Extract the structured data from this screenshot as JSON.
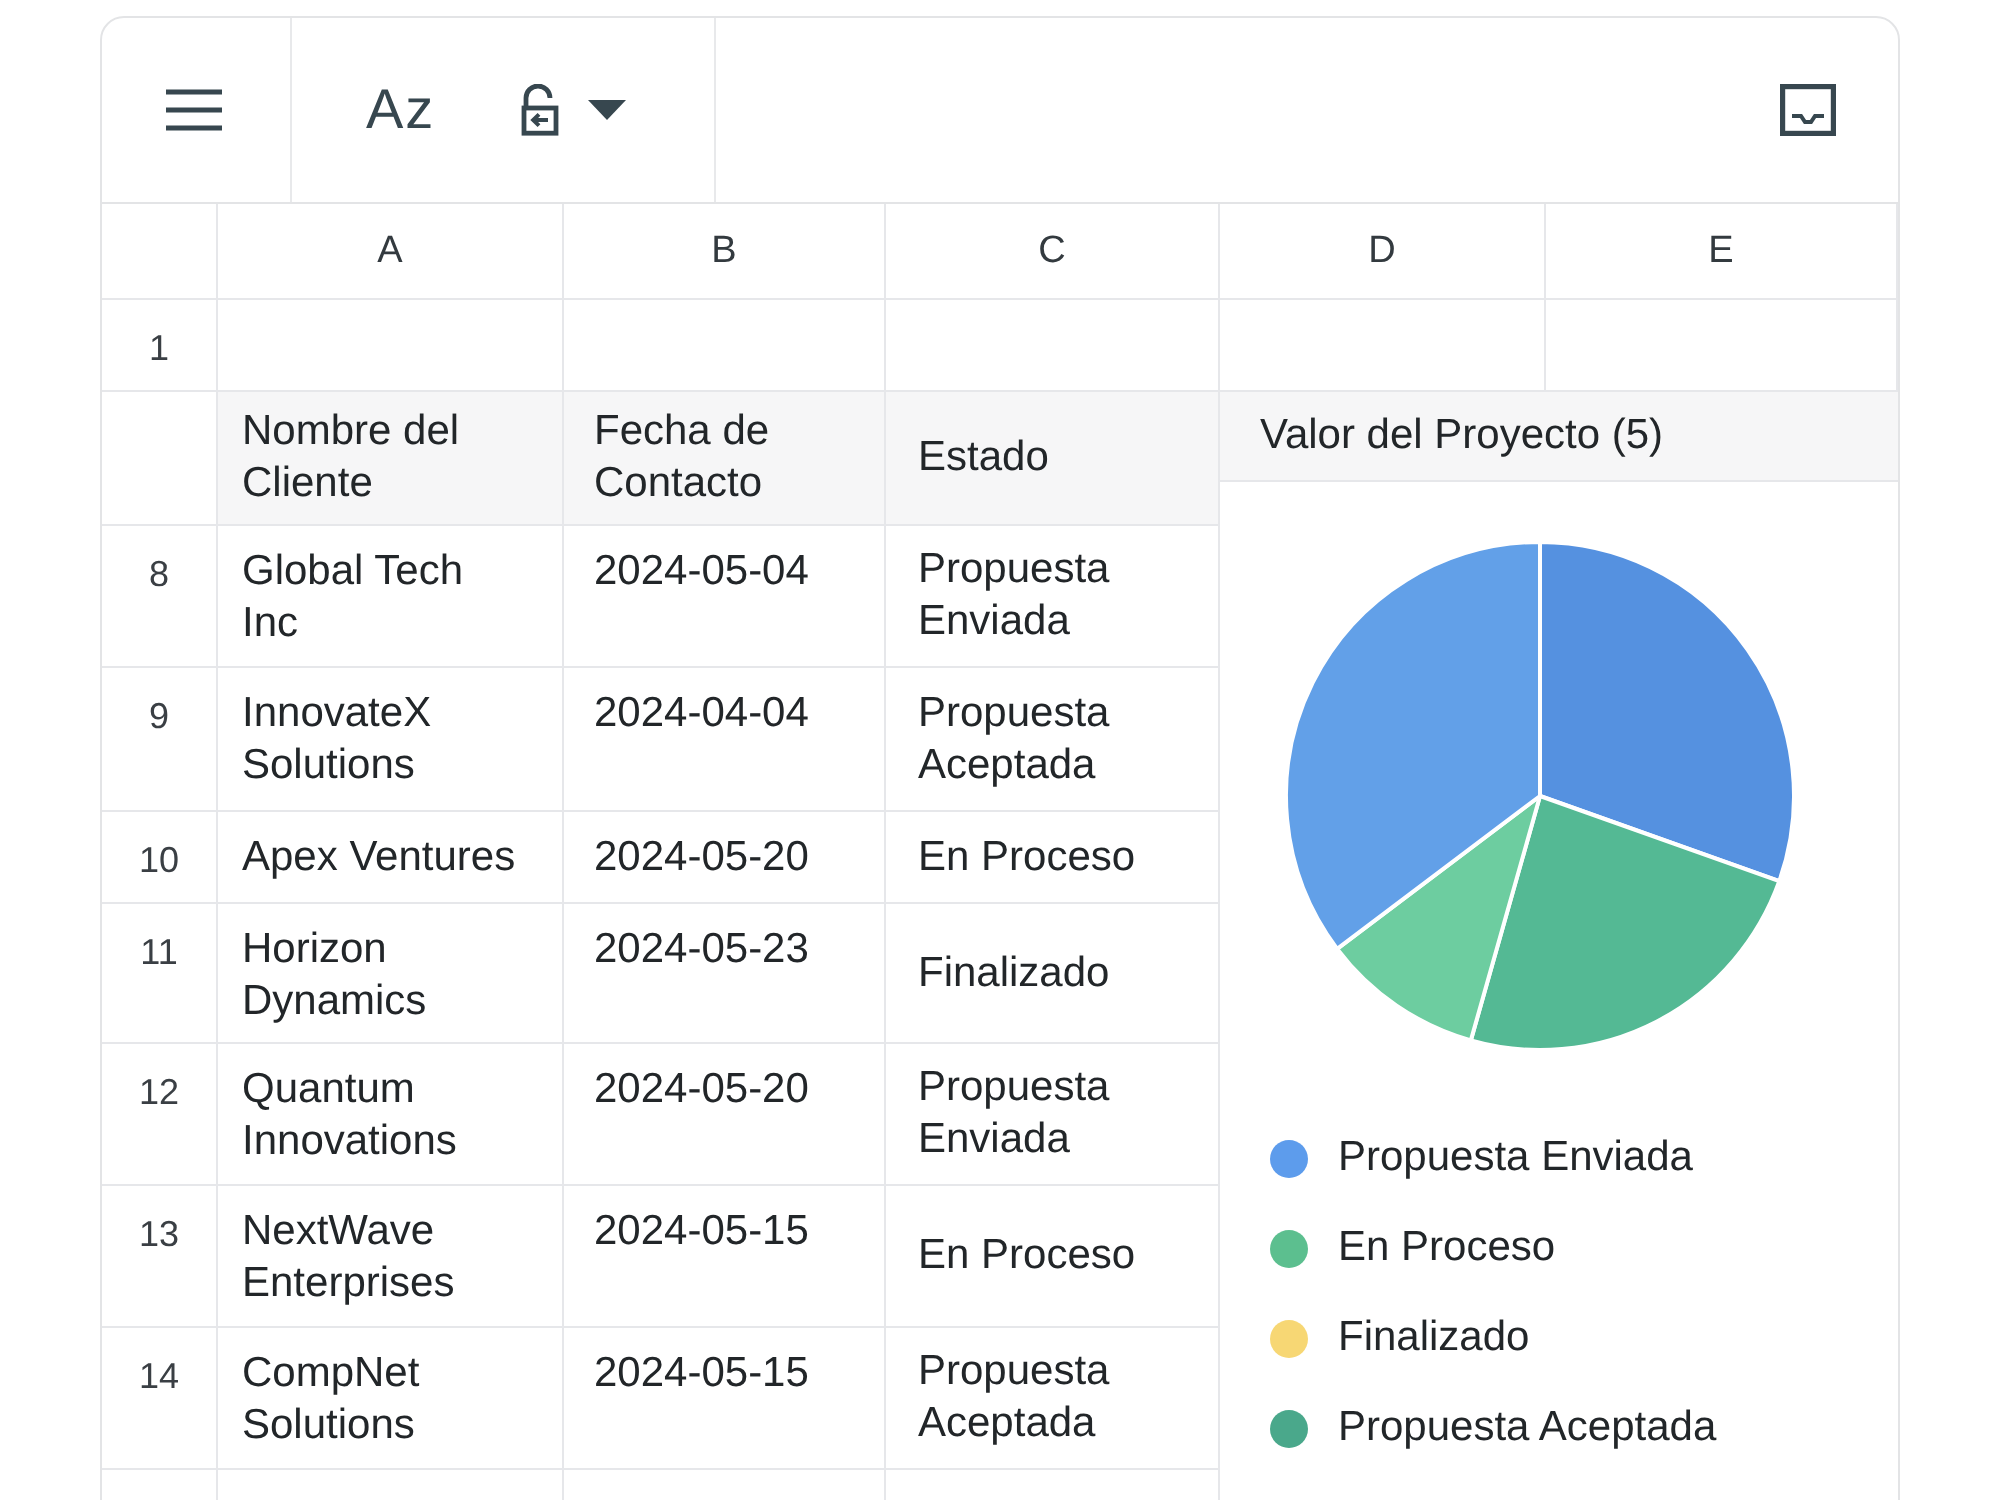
{
  "toolbar": {
    "sort_button": "Az"
  },
  "column_headers": [
    "A",
    "B",
    "C",
    "D",
    "E"
  ],
  "first_row": {
    "number": "1"
  },
  "table": {
    "columns": [
      "Nombre del Cliente",
      "Fecha de Contacto",
      "Estado"
    ],
    "rows": [
      {
        "number": "8",
        "client": "Global Tech Inc",
        "date": "2024-05-04",
        "status": "Propuesta Enviada"
      },
      {
        "number": "9",
        "client": "InnovateX Solutions",
        "date": "2024-04-04",
        "status": "Propuesta Aceptada"
      },
      {
        "number": "10",
        "client": "Apex Ventures",
        "date": "2024-05-20",
        "status": "En Proceso"
      },
      {
        "number": "11",
        "client": "Horizon Dynamics",
        "date": "2024-05-23",
        "status": "Finalizado"
      },
      {
        "number": "12",
        "client": "Quantum Innovations",
        "date": "2024-05-20",
        "status": "Propuesta Enviada"
      },
      {
        "number": "13",
        "client": "NextWave Enterprises",
        "date": "2024-05-15",
        "status": "En Proceso"
      },
      {
        "number": "14",
        "client": "CompNet Solutions",
        "date": "2024-05-15",
        "status": "Propuesta Aceptada"
      }
    ]
  },
  "chart_panel": {
    "title": "Valor del Proyecto (5)",
    "legend": [
      {
        "label": "Propuesta Enviada",
        "color": "#5d9cec"
      },
      {
        "label": "En Proceso",
        "color": "#5cbf8f"
      },
      {
        "label": "Finalizado",
        "color": "#f7d774"
      },
      {
        "label": "Propuesta Aceptada",
        "color": "#4aa88b"
      }
    ]
  }
}
